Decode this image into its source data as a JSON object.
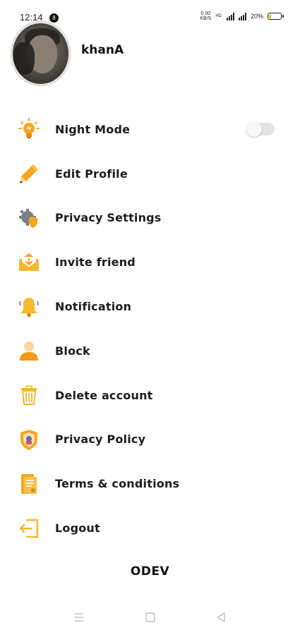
{
  "status_bar": {
    "time": "12:14",
    "notification_badge": "8",
    "net_speed_value": "0.00",
    "net_speed_unit": "KB/S",
    "network_tag": "HD",
    "battery_percent": "20%",
    "battery_level": 0.2
  },
  "profile": {
    "username": "khanA"
  },
  "menu": {
    "items": [
      {
        "label": "Night Mode",
        "icon": "lightbulb-icon",
        "has_toggle": true,
        "toggle_on": false
      },
      {
        "label": "Edit Profile",
        "icon": "pencil-icon"
      },
      {
        "label": "Privacy Settings",
        "icon": "gear-shield-icon"
      },
      {
        "label": "Invite friend",
        "icon": "envelope-icon"
      },
      {
        "label": "Notification",
        "icon": "bell-icon"
      },
      {
        "label": "Block",
        "icon": "user-icon"
      },
      {
        "label": "Delete account",
        "icon": "trash-icon"
      },
      {
        "label": "Privacy Policy",
        "icon": "shield-icon"
      },
      {
        "label": "Terms & conditions",
        "icon": "document-icon"
      },
      {
        "label": "Logout",
        "icon": "logout-icon"
      }
    ]
  },
  "brand": {
    "name": "ODEV"
  },
  "colors": {
    "accent_orange": "#f5a623",
    "accent_yellow": "#ffc928",
    "text": "#1c1c1c",
    "toggle_track": "#e3e3e3"
  },
  "navbar": {
    "icons": [
      "menu-icon",
      "home-square-icon",
      "back-triangle-icon"
    ]
  }
}
